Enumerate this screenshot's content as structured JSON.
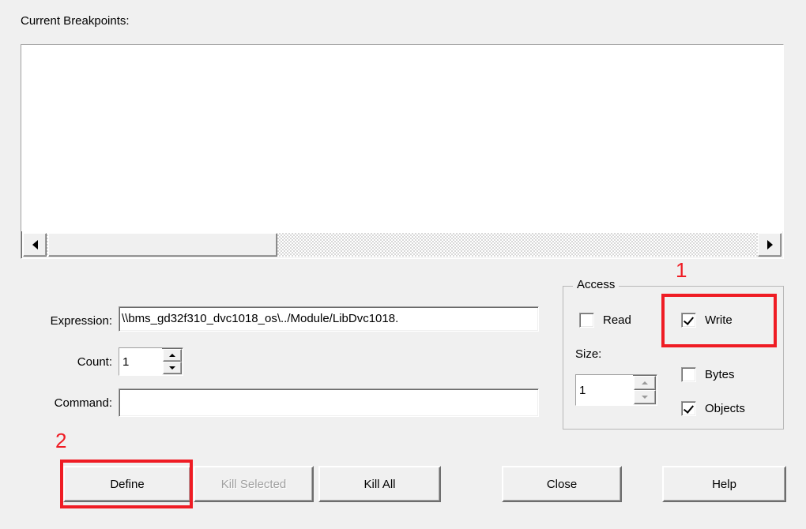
{
  "dialog": {
    "list_label": "Current Breakpoints:",
    "list_items": []
  },
  "scrollbar": {
    "left_arrow_icon": "arrow-left-icon",
    "right_arrow_icon": "arrow-right-icon"
  },
  "form": {
    "expression_label": "Expression:",
    "expression_value": "\\\\bms_gd32f310_dvc1018_os\\../Module/LibDvc1018.",
    "expression_placeholder": "",
    "count_label": "Count:",
    "count_value": "1",
    "command_label": "Command:",
    "command_value": "",
    "command_placeholder": ""
  },
  "access": {
    "legend": "Access",
    "read_label": "Read",
    "read_checked": false,
    "write_label": "Write",
    "write_checked": true,
    "size_label": "Size:",
    "size_value": "1",
    "bytes_label": "Bytes",
    "bytes_checked": false,
    "objects_label": "Objects",
    "objects_checked": true
  },
  "buttons": {
    "define": "Define",
    "kill_selected": "Kill Selected",
    "kill_all": "Kill All",
    "close": "Close",
    "help": "Help"
  },
  "annotations": {
    "step_1": "1",
    "step_2": "2",
    "color": "#ef1c24"
  }
}
